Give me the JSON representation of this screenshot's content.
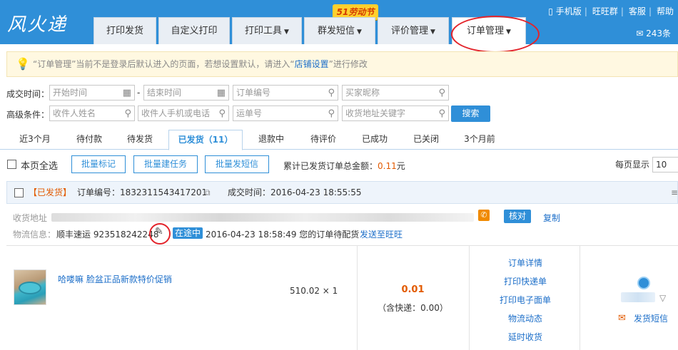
{
  "app": {
    "logo": "风火递"
  },
  "promo": "51劳动节",
  "nav_tabs": [
    {
      "label": "打印发货",
      "dropdown": false,
      "active": false
    },
    {
      "label": "自定义打印",
      "dropdown": false,
      "active": false
    },
    {
      "label": "打印工具",
      "dropdown": true,
      "active": false
    },
    {
      "label": "群发短信",
      "dropdown": true,
      "active": false
    },
    {
      "label": "评价管理",
      "dropdown": true,
      "active": false
    },
    {
      "label": "订单管理",
      "dropdown": true,
      "active": true
    }
  ],
  "top_links": [
    "手机版",
    "旺旺群",
    "客服",
    "帮助"
  ],
  "messages": {
    "count": "243条"
  },
  "notice": {
    "prefix": "“订单管理”当前不是登录后默认进入的页面，若想设置默认，请进入“",
    "link": "店铺设置",
    "suffix": "”进行修改"
  },
  "filters": {
    "deal_time_label": "成交时间：",
    "start_time": "开始时间",
    "dash": "-",
    "end_time": "结束时间",
    "order_no": "订单编号",
    "buyer_nick": "买家昵称",
    "advanced_label": "高级条件：",
    "receiver_name": "收件人姓名",
    "receiver_phone": "收件人手机或电话",
    "waybill_no": "运单号",
    "address_keyword": "收货地址关键字",
    "search_btn": "搜索"
  },
  "status_tabs": [
    {
      "label": "近3个月",
      "active": false
    },
    {
      "label": "待付款",
      "active": false
    },
    {
      "label": "待发货",
      "active": false
    },
    {
      "label": "已发货（11）",
      "active": true
    },
    {
      "label": "退款中",
      "active": false
    },
    {
      "label": "待评价",
      "active": false
    },
    {
      "label": "已成功",
      "active": false
    },
    {
      "label": "已关闭",
      "active": false
    },
    {
      "label": "3个月前",
      "active": false
    }
  ],
  "toolbar": {
    "select_all": "本页全选",
    "batch_mark": "批量标记",
    "batch_task": "批量建任务",
    "batch_sms": "批量发短信",
    "total_label": "累计已发货订单总金额：",
    "total_amount": "0.11",
    "total_unit": "元",
    "per_page_label": "每页显示",
    "per_page_value": "10"
  },
  "order": {
    "status": "【已发货】",
    "order_no_label": "订单编号：",
    "order_no": "1832311543417201",
    "deal_time_label": "成交时间：",
    "deal_time": "2016-04-23 18:55:55",
    "address_label": "收货地址",
    "verify_btn": "核对",
    "copy_link": "复制",
    "logistics_label": "物流信息：",
    "carrier": "顺丰速运",
    "tracking_no": "92351824224",
    "tracking_tail": "8",
    "in_transit": "在途中",
    "logistics_time": "2016-04-23 18:58:49",
    "logistics_msg": "您的订单待配货",
    "send_to_wangwang": "发送至旺旺",
    "item_title": "哈喽嘛 脸盆正品新款特价促销",
    "item_price_qty": "510.02 × 1",
    "amount": "0.01",
    "shipping": "（含快递：0.00）",
    "actions": [
      "订单详情",
      "打印快递单",
      "打印电子面单",
      "物流动态",
      "延时收货"
    ],
    "send_sms": "发货短信"
  },
  "colors": {
    "brand": "#2f8fd8",
    "accent": "#e25a00",
    "annotation": "#e3242b"
  }
}
